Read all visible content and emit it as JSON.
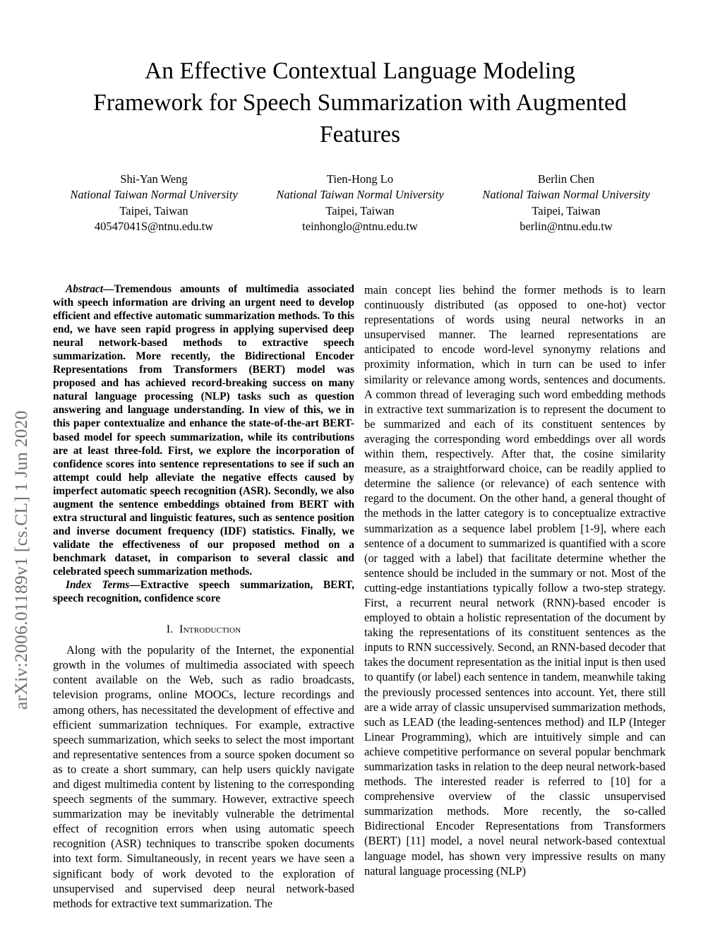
{
  "arxiv": {
    "stamp": "arXiv:2006.01189v1  [cs.CL]  1 Jun 2020"
  },
  "title": "An Effective Contextual Language Modeling Framework for Speech Summarization with Augmented Features",
  "authors": [
    {
      "name": "Shi-Yan Weng",
      "affiliation": "National Taiwan Normal University",
      "location": "Taipei, Taiwan",
      "email": "40547041S@ntnu.edu.tw"
    },
    {
      "name": "Tien-Hong Lo",
      "affiliation": "National Taiwan Normal University",
      "location": "Taipei, Taiwan",
      "email": "teinhonglo@ntnu.edu.tw"
    },
    {
      "name": "Berlin Chen",
      "affiliation": "National Taiwan Normal University",
      "location": "Taipei, Taiwan",
      "email": "berlin@ntnu.edu.tw"
    }
  ],
  "abstract": {
    "lead": "Abstract",
    "dash": "—",
    "text": "Tremendous amounts of multimedia associated with speech information are driving an urgent need to develop efficient and effective automatic summarization methods. To this end, we have seen rapid progress in applying supervised deep neural network-based methods to extractive speech summarization. More recently, the Bidirectional Encoder Representations from Transformers (BERT) model was proposed and has achieved record-breaking success on many natural language processing (NLP) tasks such as question answering and language understanding. In view of this, we in this paper contextualize and enhance the state-of-the-art BERT-based model for speech summarization, while its contributions are at least three-fold. First, we explore the incorporation of confidence scores into sentence representations to see if such an attempt could help alleviate the negative effects caused by imperfect automatic speech recognition (ASR). Secondly, we also augment the sentence embeddings obtained from BERT with extra structural and linguistic features, such as sentence position and inverse document frequency (IDF) statistics. Finally, we validate the effectiveness of our proposed method on a benchmark dataset, in comparison to several classic and celebrated speech summarization methods."
  },
  "index_terms": {
    "lead": "Index Terms",
    "dash": "—",
    "text": "Extractive speech summarization, BERT, speech recognition, confidence score"
  },
  "sections": {
    "introduction": {
      "numeral": "I.",
      "name": "Introduction",
      "paragraph_left": "Along with the popularity of the Internet, the exponential growth in the volumes of multimedia associated with speech content available on the Web, such as radio broadcasts, television programs, online MOOCs, lecture recordings and among others, has necessitated the development of effective and efficient summarization techniques. For example, extractive speech summarization, which seeks to select the most important and representative sentences from a source spoken document so as to create a short summary, can help users quickly navigate and digest multimedia content by listening to the corresponding speech segments of the summary. However, extractive speech summarization may be inevitably vulnerable the detrimental effect of recognition errors when using automatic speech recognition (ASR) techniques to transcribe spoken documents into text form. Simultaneously, in recent years we have seen a significant body of work devoted to the exploration of unsupervised and supervised deep neural network-based methods for extractive text summarization. The",
      "paragraph_right": "main concept lies behind the former methods is to learn continuously distributed (as opposed to one-hot) vector representations of words using neural networks in an unsupervised manner. The learned representations are anticipated to encode word-level synonymy relations and proximity information, which in turn can be used to infer similarity or relevance among words, sentences and documents. A common thread of leveraging such word embedding methods in extractive text summarization is to represent the document to be summarized and each of its constituent sentences by averaging the corresponding word embeddings over all words within them, respectively. After that, the cosine similarity measure, as a straightforward choice, can be readily applied to determine the salience (or relevance) of each sentence with regard to the document. On the other hand, a general thought of the methods in the latter category is to conceptualize extractive summarization as a sequence label problem [1-9], where each sentence of a document to summarized is quantified with a score (or tagged with a label) that facilitate determine whether the sentence should be included in the summary or not. Most of the cutting-edge instantiations typically follow a two-step strategy. First, a recurrent neural network (RNN)-based encoder is employed to obtain a holistic representation of the document by taking the representations of its constituent sentences as the inputs to RNN successively. Second, an RNN-based decoder that takes the document representation as the initial input is then used to quantify (or label) each sentence in tandem, meanwhile taking the previously processed sentences into account. Yet, there still are a wide array of classic unsupervised summarization methods, such as LEAD (the leading-sentences method) and ILP (Integer Linear Programming), which are intuitively simple and can achieve competitive performance on several popular benchmark summarization tasks in relation to the deep neural network-based methods. The interested reader is referred to [10] for a comprehensive overview of the classic unsupervised summarization methods. More recently, the so-called Bidirectional Encoder Representations from Transformers (BERT) [11] model, a novel neural network-based contextual language model, has shown very impressive results on many natural language processing (NLP)"
    }
  }
}
